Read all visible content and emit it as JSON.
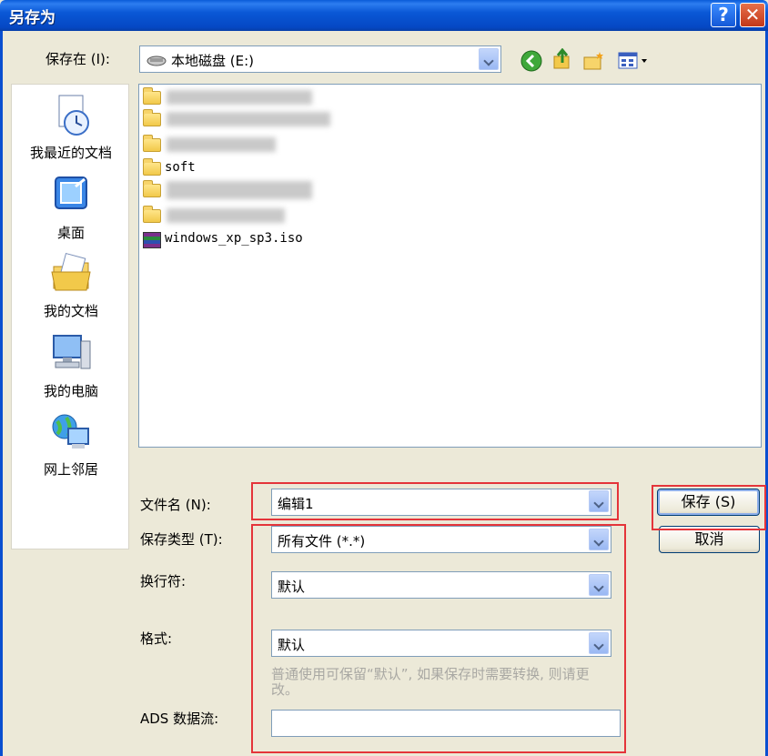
{
  "window": {
    "title": "另存为",
    "help_glyph": "?",
    "close_glyph": "✕"
  },
  "lookin": {
    "label": "保存在 (I):",
    "value": "本地磁盘 (E:)"
  },
  "places": [
    {
      "label": "我最近的文档",
      "icon": "recent-documents-icon"
    },
    {
      "label": "桌面",
      "icon": "desktop-icon"
    },
    {
      "label": "我的文档",
      "icon": "my-documents-icon"
    },
    {
      "label": "我的电脑",
      "icon": "my-computer-icon"
    },
    {
      "label": "网上邻居",
      "icon": "network-places-icon"
    }
  ],
  "files": [
    {
      "name": "",
      "type": "folder",
      "blurred": true
    },
    {
      "name": "",
      "type": "folder",
      "blurred": true
    },
    {
      "name": "",
      "type": "folder",
      "blurred": true
    },
    {
      "name": "soft",
      "type": "folder",
      "blurred": false
    },
    {
      "name": "",
      "type": "folder",
      "blurred": true
    },
    {
      "name": "",
      "type": "folder",
      "blurred": true
    },
    {
      "name": "windows_xp_sp3.iso",
      "type": "archive",
      "blurred": false
    }
  ],
  "form": {
    "filename_label": "文件名 (N):",
    "filename_value": "编辑1",
    "filetype_label": "保存类型 (T):",
    "filetype_value": "所有文件 (*.*)",
    "linebreak_label": "换行符:",
    "linebreak_value": "默认",
    "format_label": "格式:",
    "format_value": "默认",
    "hint": "普通使用可保留“默认”, 如果保存时需要转换, 则请更改。",
    "ads_label": "ADS 数据流:",
    "ads_value": ""
  },
  "buttons": {
    "save": "保存 (S)",
    "cancel": "取消"
  },
  "colors": {
    "titlebar": "#0a58d6",
    "dialog_bg": "#ece9d8",
    "highlight_box": "#e4343a"
  }
}
